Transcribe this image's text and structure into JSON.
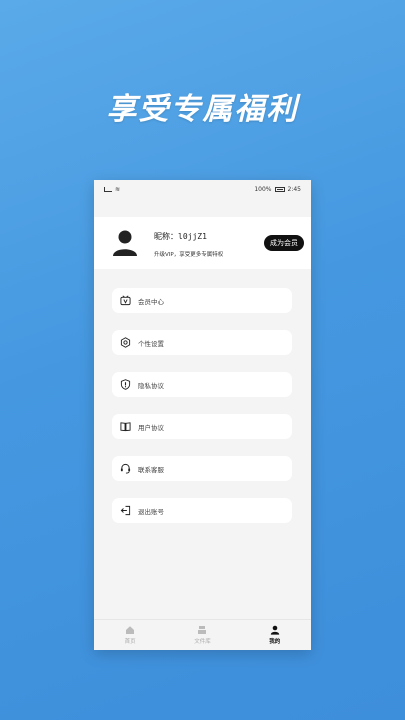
{
  "promo": {
    "title": "享受专属福利"
  },
  "status_bar": {
    "battery": "100%",
    "time": "2:45"
  },
  "profile": {
    "nickname_label": "昵称：",
    "nickname": "l0jjZ1",
    "vip_tip": "升级VIP，享受更多专属特权",
    "vip_button": "成为会员"
  },
  "menu": [
    {
      "label": "会员中心",
      "icon": "vip-icon"
    },
    {
      "label": "个性设置",
      "icon": "gear-icon"
    },
    {
      "label": "隐私协议",
      "icon": "shield-icon"
    },
    {
      "label": "用户协议",
      "icon": "book-icon"
    },
    {
      "label": "联系客服",
      "icon": "headset-icon"
    },
    {
      "label": "退出账号",
      "icon": "logout-icon"
    }
  ],
  "tabs": [
    {
      "label": "首页",
      "icon": "home-icon",
      "active": false
    },
    {
      "label": "文件库",
      "icon": "files-icon",
      "active": false
    },
    {
      "label": "我的",
      "icon": "user-icon",
      "active": true
    }
  ]
}
